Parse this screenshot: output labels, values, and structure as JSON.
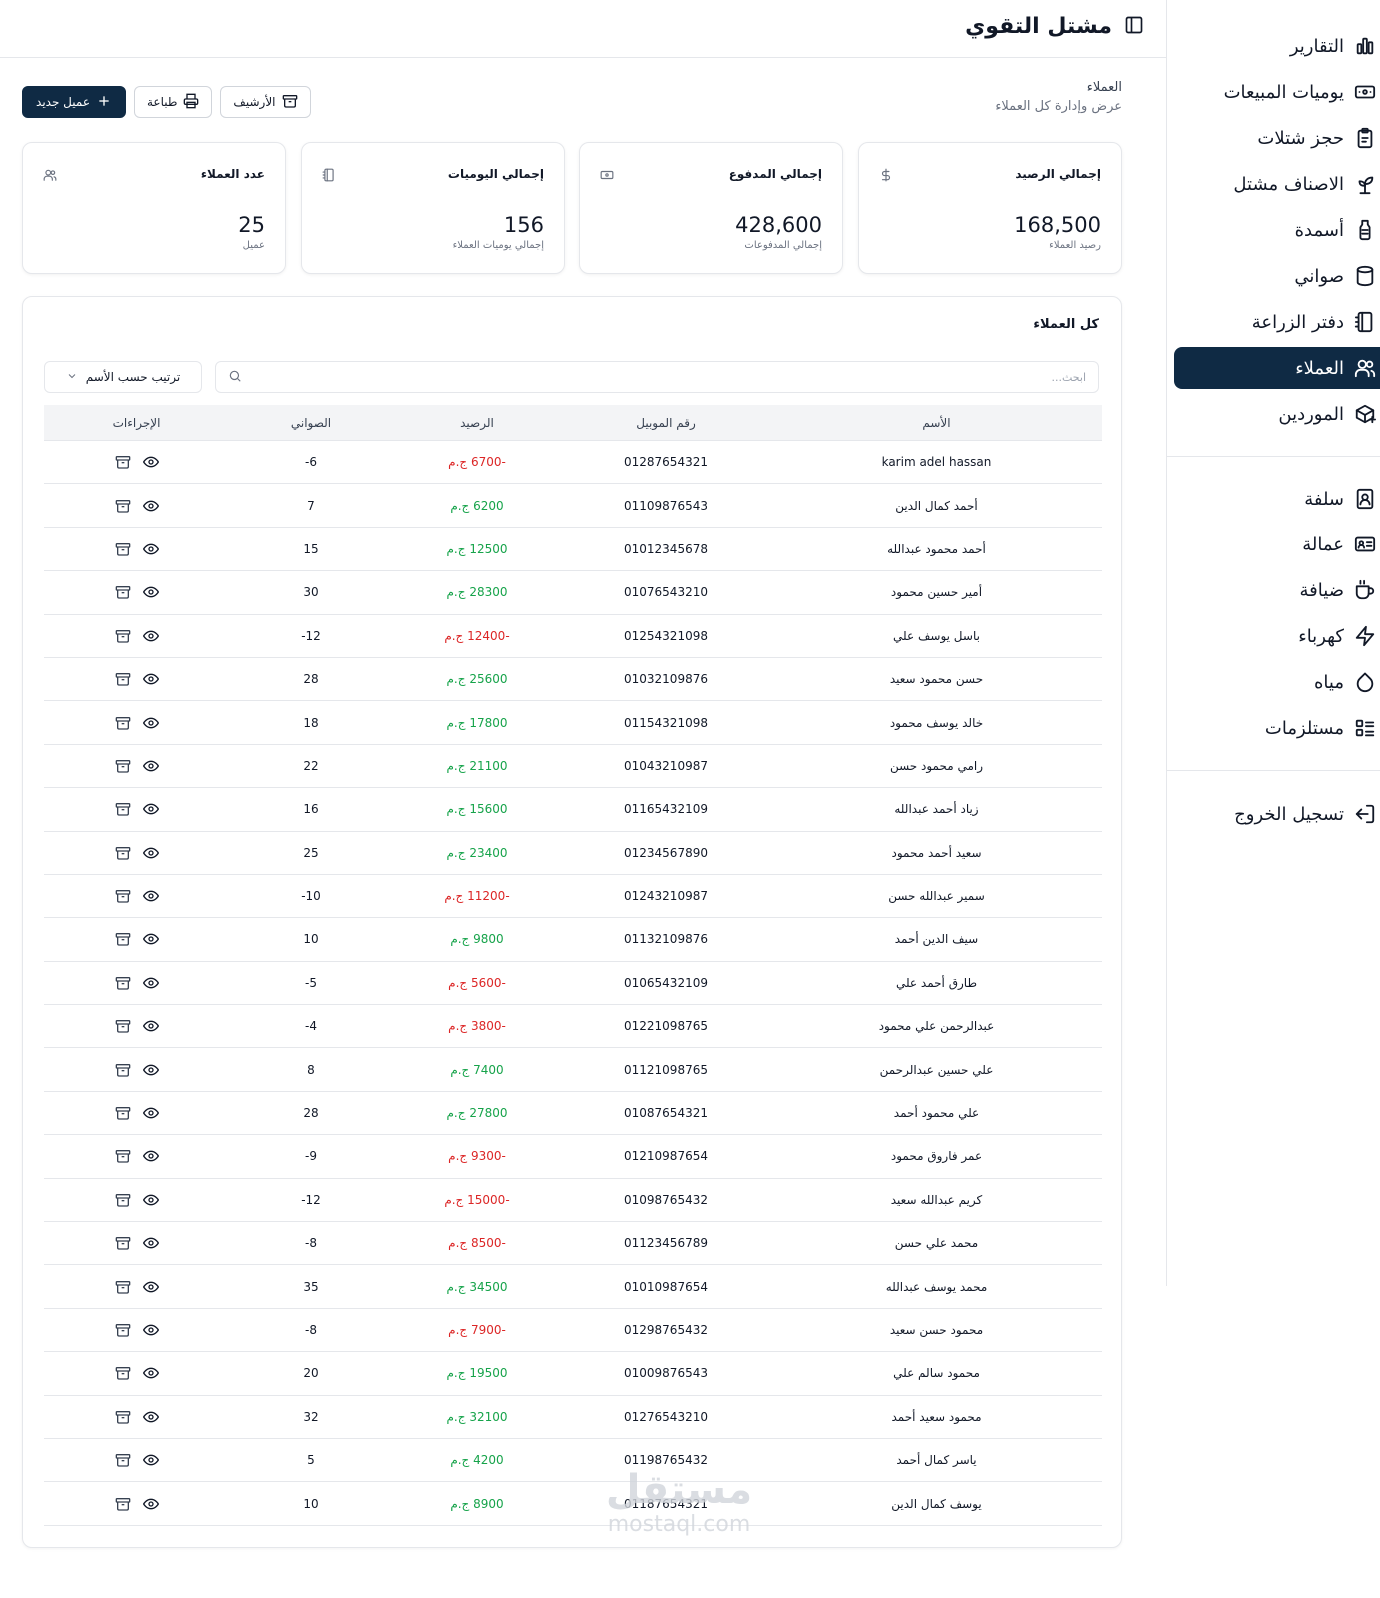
{
  "app": {
    "title": "مشتل التقوي"
  },
  "sidebar": {
    "items": [
      {
        "label": "التقارير",
        "icon": "bar-chart-icon",
        "active": false
      },
      {
        "label": "يوميات المبيعات",
        "icon": "cash-icon",
        "active": false
      },
      {
        "label": "حجز شتلات",
        "icon": "clipboard-icon",
        "active": false
      },
      {
        "label": "الاصناف مشتل",
        "icon": "sprout-icon",
        "active": false
      },
      {
        "label": "أسمدة",
        "icon": "bottle-icon",
        "active": false
      },
      {
        "label": "صواني",
        "icon": "cylinder-icon",
        "active": false
      },
      {
        "label": "دفتر الزراعة",
        "icon": "notebook-icon",
        "active": false
      },
      {
        "label": "العملاء",
        "icon": "users-icon",
        "active": true
      },
      {
        "label": "الموردين",
        "icon": "package-icon",
        "active": false
      },
      {
        "label": "سلفة",
        "icon": "contact-card-icon",
        "active": false
      },
      {
        "label": "عمالة",
        "icon": "id-card-icon",
        "active": false
      },
      {
        "label": "ضيافة",
        "icon": "cup-icon",
        "active": false
      },
      {
        "label": "كهرباء",
        "icon": "lightning-icon",
        "active": false
      },
      {
        "label": "مياه",
        "icon": "droplet-icon",
        "active": false
      },
      {
        "label": "مستلزمات",
        "icon": "list-icon",
        "active": false
      },
      {
        "label": "تسجيل الخروج",
        "icon": "logout-icon",
        "active": false
      }
    ]
  },
  "breadcrumb": {
    "title": "العملاء",
    "subtitle": "عرض وإدارة كل العملاء"
  },
  "toolbar": {
    "new_label": "عميل جديد",
    "print_label": "طباعة",
    "archive_label": "الأرشيف"
  },
  "cards": [
    {
      "label": "إجمالي الرصيد",
      "value": "168,500",
      "sub": "رصيد العملاء",
      "icon": "dollar-icon"
    },
    {
      "label": "إجمالي المدفوع",
      "value": "428,600",
      "sub": "إجمالي المدفوعات",
      "icon": "banknote-icon"
    },
    {
      "label": "إجمالي اليوميات",
      "value": "156",
      "sub": "إجمالي يوميات العملاء",
      "icon": "notebook-icon"
    },
    {
      "label": "عدد العملاء",
      "value": "25",
      "sub": "عميل",
      "icon": "users-icon"
    }
  ],
  "table": {
    "title": "كل العملاء",
    "search_placeholder": "ابحث...",
    "sort_label": "ترتيب حسب الأسم",
    "columns": [
      "الأسم",
      "رقم الموبيل",
      "الرصيد",
      "الصواني",
      "الإجراءات"
    ],
    "currency": "ج.م",
    "rows": [
      {
        "name": "karim adel hassan",
        "phone": "01287654321",
        "balance": "-6700",
        "trays": "-6"
      },
      {
        "name": "أحمد كمال الدين",
        "phone": "01109876543",
        "balance": "6200",
        "trays": "7"
      },
      {
        "name": "أحمد محمود عبدالله",
        "phone": "01012345678",
        "balance": "12500",
        "trays": "15"
      },
      {
        "name": "أمير حسين محمود",
        "phone": "01076543210",
        "balance": "28300",
        "trays": "30"
      },
      {
        "name": "باسل يوسف علي",
        "phone": "01254321098",
        "balance": "-12400",
        "trays": "-12"
      },
      {
        "name": "حسن محمود سعيد",
        "phone": "01032109876",
        "balance": "25600",
        "trays": "28"
      },
      {
        "name": "خالد يوسف محمود",
        "phone": "01154321098",
        "balance": "17800",
        "trays": "18"
      },
      {
        "name": "رامي محمود حسن",
        "phone": "01043210987",
        "balance": "21100",
        "trays": "22"
      },
      {
        "name": "زياد أحمد عبدالله",
        "phone": "01165432109",
        "balance": "15600",
        "trays": "16"
      },
      {
        "name": "سعيد أحمد محمود",
        "phone": "01234567890",
        "balance": "23400",
        "trays": "25"
      },
      {
        "name": "سمير عبدالله حسن",
        "phone": "01243210987",
        "balance": "-11200",
        "trays": "-10"
      },
      {
        "name": "سيف الدين أحمد",
        "phone": "01132109876",
        "balance": "9800",
        "trays": "10"
      },
      {
        "name": "طارق أحمد علي",
        "phone": "01065432109",
        "balance": "-5600",
        "trays": "-5"
      },
      {
        "name": "عبدالرحمن علي محمود",
        "phone": "01221098765",
        "balance": "-3800",
        "trays": "-4"
      },
      {
        "name": "علي حسين عبدالرحمن",
        "phone": "01121098765",
        "balance": "7400",
        "trays": "8"
      },
      {
        "name": "علي محمود أحمد",
        "phone": "01087654321",
        "balance": "27800",
        "trays": "28"
      },
      {
        "name": "عمر فاروق محمود",
        "phone": "01210987654",
        "balance": "-9300",
        "trays": "-9"
      },
      {
        "name": "كريم عبدالله سعيد",
        "phone": "01098765432",
        "balance": "-15000",
        "trays": "-12"
      },
      {
        "name": "محمد علي حسن",
        "phone": "01123456789",
        "balance": "-8500",
        "trays": "-8"
      },
      {
        "name": "محمد يوسف عبدالله",
        "phone": "01010987654",
        "balance": "34500",
        "trays": "35"
      },
      {
        "name": "محمود حسن سعيد",
        "phone": "01298765432",
        "balance": "-7900",
        "trays": "-8"
      },
      {
        "name": "محمود سالم علي",
        "phone": "01009876543",
        "balance": "19500",
        "trays": "20"
      },
      {
        "name": "محمود سعيد أحمد",
        "phone": "01276543210",
        "balance": "32100",
        "trays": "32"
      },
      {
        "name": "ياسر كمال أحمد",
        "phone": "01198765432",
        "balance": "4200",
        "trays": "5"
      },
      {
        "name": "يوسف كمال الدين",
        "phone": "01187654321",
        "balance": "8900",
        "trays": "10"
      }
    ]
  },
  "watermark": {
    "line1": "مستقل",
    "line2": "mostaql.com"
  },
  "colors": {
    "primary": "#0f2a44",
    "positive": "#16a34a",
    "negative": "#dc2626"
  }
}
